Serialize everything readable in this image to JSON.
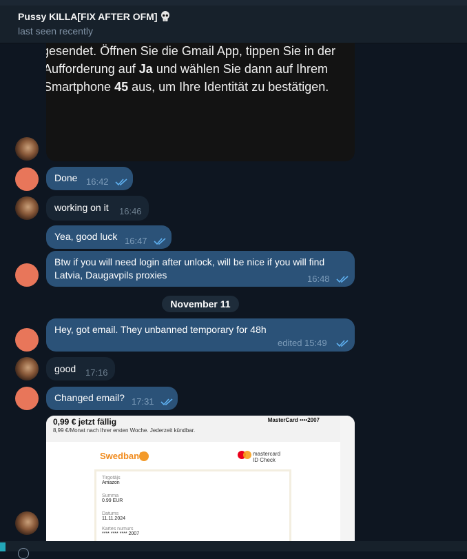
{
  "header": {
    "title": "Pussy KILLA[FIX AFTER OFM]",
    "status": "last seen recently"
  },
  "media_top": {
    "line1": "gesendet. Öffnen Sie die Gmail App, tippen Sie in der",
    "line2_a": "Aufforderung auf ",
    "line2_b": "Ja",
    "line2_c": " und wählen Sie dann auf Ihrem",
    "line3_a": "Smartphone ",
    "line3_b": "45",
    "line3_c": " aus, um Ihre Identität zu bestätigen."
  },
  "messages": [
    {
      "text": "Done",
      "time": "16:42"
    },
    {
      "text": "working on it",
      "time": "16:46"
    },
    {
      "text": "Yea, good luck",
      "time": "16:47"
    },
    {
      "text": "Btw if you will need login after unlock, will be nice if you will find",
      "text2": "Latvia, Daugavpils proxies",
      "time": "16:48"
    },
    {
      "text": "Hey, got email. They unbanned temporary for 48h",
      "time": "edited 15:49"
    },
    {
      "text": "good",
      "time": "17:16"
    },
    {
      "text": "Changed email?",
      "time": "17:31"
    }
  ],
  "date_divider": "November 11",
  "payment_screenshot": {
    "due": "0,99 € jetzt fällig",
    "subline": "8,99 €/Monat nach Ihrer ersten Woche. Jederzeit kündbar.",
    "card": "MasterCard ••••2007",
    "bank": "Swedbank",
    "mc_line1": "mastercard",
    "mc_line2": "ID Check",
    "fields": [
      {
        "label": "Tirgotājs",
        "value": "Amazon"
      },
      {
        "label": "Summa",
        "value": "0.99 EUR"
      },
      {
        "label": "Datums",
        "value": "11.11.2024"
      },
      {
        "label": "Kartes numurs",
        "value": "**** **** **** 2007"
      }
    ]
  },
  "colors": {
    "background": "#0e1621",
    "outgoing_bubble": "#2b5278",
    "incoming_bubble": "#182533",
    "read_check": "#5fb0f0"
  }
}
